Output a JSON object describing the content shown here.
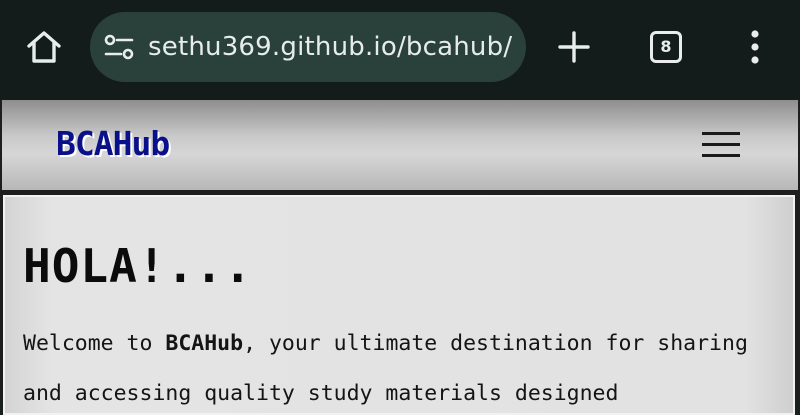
{
  "browser": {
    "url": "sethu369.github.io/bcahub/",
    "tab_count": "8",
    "icons": {
      "home": "home-icon",
      "site_settings": "tune-icon",
      "new_tab": "plus-icon",
      "tabs": "tab-switcher-icon",
      "menu": "more-vert-icon"
    },
    "colors": {
      "toolbar": "#131c1b",
      "url_pill": "#2a403b",
      "icon": "#e8ecea"
    }
  },
  "site": {
    "brand": "BCAHub",
    "brand_color": "#0a108a",
    "menu_icon": "hamburger-icon",
    "heading": "HOLA!...",
    "intro": {
      "lead": "Welcome to ",
      "brand": "BCAHub",
      "line1_rest": ", your ultimate destination for sharing",
      "line2": "and accessing quality study materials designed"
    }
  }
}
